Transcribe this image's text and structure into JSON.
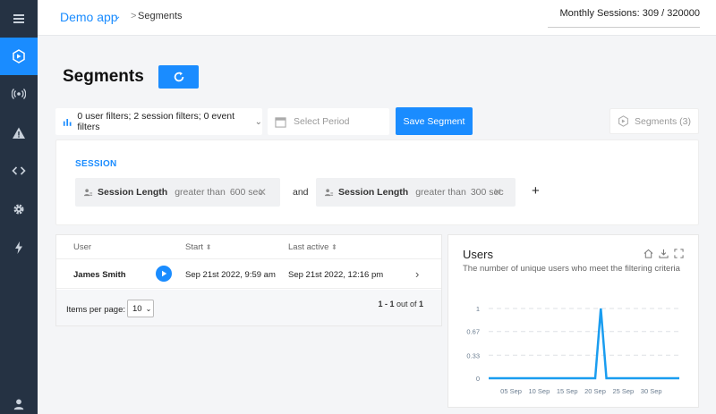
{
  "header": {
    "app_name": "Demo app",
    "breadcrumb_sep": ">",
    "breadcrumb": "Segments",
    "monthly_sessions": "Monthly Sessions: 309 / 320000"
  },
  "sidebar": {
    "items": [
      {
        "icon": "menu-icon"
      },
      {
        "icon": "segments-icon",
        "active": true
      },
      {
        "icon": "broadcast-icon"
      },
      {
        "icon": "warning-icon"
      },
      {
        "icon": "code-icon"
      },
      {
        "icon": "gear-icon"
      },
      {
        "icon": "lightning-icon"
      },
      {
        "icon": "user-icon"
      }
    ]
  },
  "page": {
    "title": "Segments"
  },
  "toolbar": {
    "filters_summary": "0 user filters; 2 session filters; 0 event filters",
    "period_placeholder": "Select Period",
    "save_label": "Save Segment",
    "segments_label": "Segments (3)"
  },
  "session_filters": {
    "section_label": "SESSION",
    "connector": "and",
    "add": "+",
    "chips": [
      {
        "name": "Session Length",
        "operator": "greater than",
        "value": "600 sec"
      },
      {
        "name": "Session Length",
        "operator": "greater than",
        "value": "300 sec"
      }
    ]
  },
  "users_table": {
    "columns": [
      "User",
      "Start",
      "Last active"
    ],
    "sort_glyph": "⬍",
    "rows": [
      {
        "user": "James Smith",
        "start": "Sep 21st 2022, 9:59 am",
        "last_active": "Sep 21st 2022, 12:16 pm"
      }
    ],
    "items_per_page_label": "Items per page:",
    "items_per_page_value": "10",
    "pager_range": "1 - 1",
    "pager_mid": " out of ",
    "pager_total": "1"
  },
  "chart_panel": {
    "title": "Users",
    "subtitle": "The number of unique users who meet the filtering criteria"
  },
  "chart_data": {
    "type": "line",
    "title": "Users",
    "xlabel": "",
    "ylabel": "",
    "x_ticks": [
      "05 Sep",
      "10 Sep",
      "15 Sep",
      "20 Sep",
      "25 Sep",
      "30 Sep"
    ],
    "y_ticks": [
      "0",
      "0.33",
      "0.67",
      "1"
    ],
    "ylim": [
      0,
      1
    ],
    "xlim": [
      1,
      35
    ],
    "grid": true,
    "color": "#1a9df0",
    "series": [
      {
        "x": [
          1,
          2,
          3,
          4,
          5,
          6,
          7,
          8,
          9,
          10,
          11,
          12,
          13,
          14,
          15,
          16,
          17,
          18,
          19,
          20,
          21,
          22,
          23,
          24,
          25,
          26,
          27,
          28,
          29,
          30,
          31,
          32,
          33,
          34,
          35
        ],
        "values": [
          0,
          0,
          0,
          0,
          0,
          0,
          0,
          0,
          0,
          0,
          0,
          0,
          0,
          0,
          0,
          0,
          0,
          0,
          0,
          0,
          1,
          0,
          0,
          0,
          0,
          0,
          0,
          0,
          0,
          0,
          0,
          0,
          0,
          0,
          0
        ]
      }
    ]
  }
}
